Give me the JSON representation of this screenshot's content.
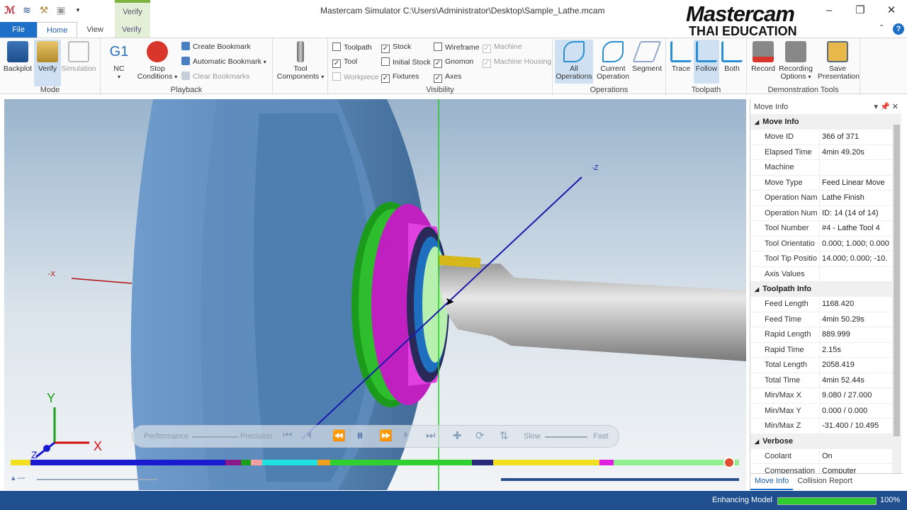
{
  "app": {
    "title": "Mastercam Simulator  C:\\Users\\Administrator\\Desktop\\Sample_Lathe.mcam",
    "context_tab": "Verify",
    "logo_line1": "Mastercam",
    "logo_line2": "THAI EDUCATION"
  },
  "tabs": [
    {
      "label": "File"
    },
    {
      "label": "Home"
    },
    {
      "label": "View"
    },
    {
      "label": "Verify"
    }
  ],
  "ribbon": {
    "mode": {
      "label": "Mode",
      "backplot": "Backplot",
      "verify": "Verify",
      "simulation": "Simulation"
    },
    "playback": {
      "label": "Playback",
      "nc": "NC",
      "nc_icon": "G1",
      "stop": "Stop Conditions",
      "create_bookmark": "Create Bookmark",
      "auto_bookmark": "Automatic Bookmark",
      "clear_bookmarks": "Clear Bookmarks"
    },
    "tool_components": "Tool Components",
    "visibility": {
      "label": "Visibility",
      "items": [
        {
          "label": "Toolpath",
          "checked": false,
          "enabled": true
        },
        {
          "label": "Tool",
          "checked": true,
          "enabled": true
        },
        {
          "label": "Workpiece",
          "checked": false,
          "enabled": false
        },
        {
          "label": "Stock",
          "checked": true,
          "enabled": true
        },
        {
          "label": "Initial Stock",
          "checked": false,
          "enabled": true
        },
        {
          "label": "Fixtures",
          "checked": true,
          "enabled": true
        },
        {
          "label": "Wireframe",
          "checked": false,
          "enabled": true
        },
        {
          "label": "Gnomon",
          "checked": true,
          "enabled": true
        },
        {
          "label": "Axes",
          "checked": true,
          "enabled": true
        },
        {
          "label": "Machine",
          "checked": true,
          "enabled": false
        },
        {
          "label": "Machine Housing",
          "checked": true,
          "enabled": false
        }
      ]
    },
    "operations": {
      "label": "Operations",
      "all": "All Operations",
      "current": "Current Operation",
      "segment": "Segment"
    },
    "toolpath": {
      "label": "Toolpath",
      "trace": "Trace",
      "follow": "Follow",
      "both": "Both"
    },
    "demo": {
      "label": "Demonstration Tools",
      "record": "Record",
      "recording_options": "Recording Options",
      "save_presentation": "Save Presentation"
    }
  },
  "viewport": {
    "axis_labels": {
      "neg_x": "-X",
      "neg_z": "-Z",
      "x": "X",
      "y": "Y",
      "z": "Z"
    },
    "playbar": {
      "performance": "Performance",
      "precision": "Precision",
      "slow": "Slow",
      "fast": "Fast"
    }
  },
  "panel": {
    "title": "Move Info",
    "sections": [
      {
        "title": "Move Info",
        "rows": [
          {
            "k": "Move ID",
            "v": "366 of 371"
          },
          {
            "k": "Elapsed Time",
            "v": "4min 49.20s"
          },
          {
            "k": "Machine",
            "v": ""
          },
          {
            "k": "Move Type",
            "v": "Feed Linear Move"
          },
          {
            "k": "Operation Nam",
            "v": "Lathe Finish"
          },
          {
            "k": "Operation Num",
            "v": "ID: 14 (14 of 14)"
          },
          {
            "k": "Tool Number",
            "v": "#4 - Lathe Tool 4"
          },
          {
            "k": "Tool Orientatio",
            "v": "0.000; 1.000; 0.000"
          },
          {
            "k": "Tool Tip Positio",
            "v": "14.000; 0.000; -10."
          },
          {
            "k": "Axis Values",
            "v": ""
          }
        ]
      },
      {
        "title": "Toolpath Info",
        "rows": [
          {
            "k": "Feed Length",
            "v": "1168.420"
          },
          {
            "k": "Feed Time",
            "v": "4min 50.29s"
          },
          {
            "k": "Rapid Length",
            "v": "889.999"
          },
          {
            "k": "Rapid Time",
            "v": "2.15s"
          },
          {
            "k": "Total Length",
            "v": "2058.419"
          },
          {
            "k": "Total Time",
            "v": "4min 52.44s"
          },
          {
            "k": "Min/Max X",
            "v": "9.080 / 27.000"
          },
          {
            "k": "Min/Max Y",
            "v": "0.000 / 0.000"
          },
          {
            "k": "Min/Max Z",
            "v": "-31.400 / 10.495"
          }
        ]
      },
      {
        "title": "Verbose",
        "rows": [
          {
            "k": "Coolant",
            "v": "On"
          },
          {
            "k": "Compensation",
            "v": "Computer"
          }
        ]
      }
    ],
    "tabs": [
      "Move Info",
      "Collision Report"
    ]
  },
  "status": {
    "text": "Enhancing Model",
    "progress": 1.0,
    "percent": "100%"
  },
  "colors": {
    "accent": "#1e6fc8",
    "status_bar": "#1f4f8f",
    "stock": "#5b8bbf",
    "tool": "#a8a8a8",
    "fixture_magenta": "#c020c0",
    "fixture_green": "#1b9a1b"
  }
}
